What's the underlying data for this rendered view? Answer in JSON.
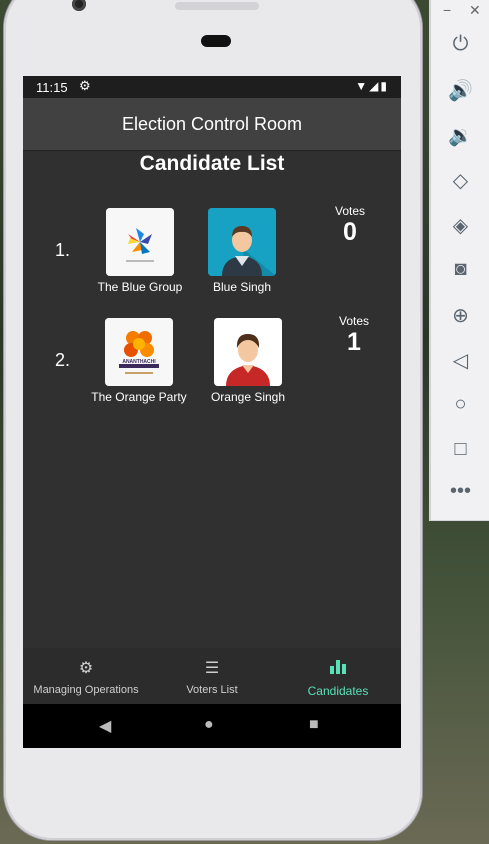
{
  "status_bar": {
    "time": "11:15"
  },
  "app_bar": {
    "title": "Election Control Room"
  },
  "page": {
    "heading": "Candidate List"
  },
  "candidates": [
    {
      "number": "1.",
      "party": "The Blue Group",
      "name": "Blue Singh",
      "votes_label": "Votes",
      "votes": "0"
    },
    {
      "number": "2.",
      "party": "The Orange Party",
      "logo_text": "ANANTHACHI",
      "name": "Orange Singh",
      "votes_label": "Votes",
      "votes": "1"
    }
  ],
  "bottom_nav": [
    {
      "label": "Managing Operations",
      "icon": "gear-icon",
      "active": false
    },
    {
      "label": "Voters List",
      "icon": "list-icon",
      "active": false
    },
    {
      "label": "Candidates",
      "icon": "bar-chart-icon",
      "active": true
    }
  ],
  "colors": {
    "accent": "#59e0b7",
    "screen_bg": "#303030",
    "app_bar_bg": "#414141",
    "avatar_blue_bg": "#17a2c4"
  },
  "side_toolbar": {
    "window_controls": [
      "minimize-icon",
      "close-icon"
    ],
    "buttons": [
      "power-icon",
      "volume-up-icon",
      "volume-down-icon",
      "rotate-left-icon",
      "rotate-right-icon",
      "camera-icon",
      "zoom-icon",
      "back-icon",
      "home-icon",
      "overview-icon",
      "more-icon"
    ]
  }
}
